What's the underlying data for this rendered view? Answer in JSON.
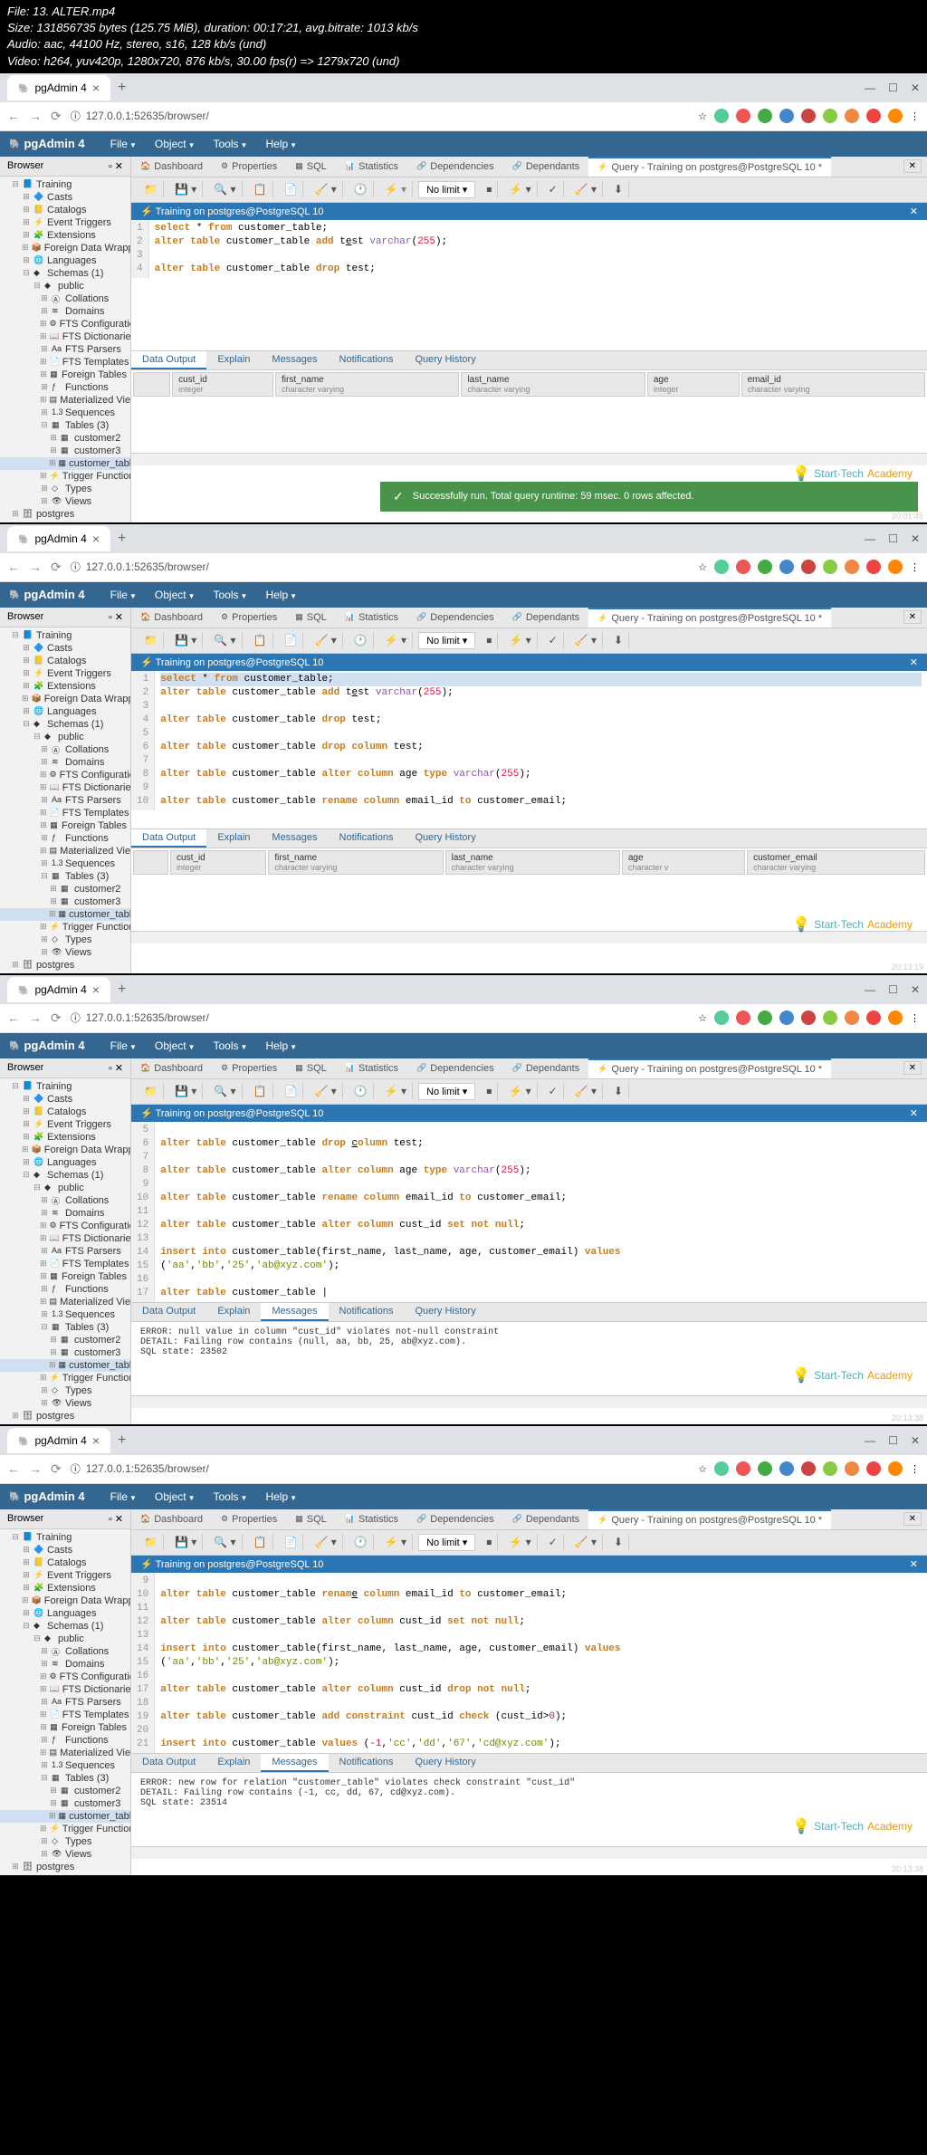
{
  "video_info": {
    "file": "File: 13. ALTER.mp4",
    "size": "Size: 131856735 bytes (125.75 MiB), duration: 00:17:21, avg.bitrate: 1013 kb/s",
    "audio": "Audio: aac, 44100 Hz, stereo, s16, 128 kb/s (und)",
    "video": "Video: h264, yuv420p, 1280x720, 876 kb/s, 30.00 fps(r) => 1279x720 (und)"
  },
  "chrome": {
    "tab_title": "pgAdmin 4",
    "url": "127.0.0.1:52635/browser/",
    "info_icon": "ⓘ"
  },
  "pgadmin": {
    "logo_text": "pgAdmin 4",
    "menu": [
      "File",
      "Object",
      "Tools",
      "Help"
    ]
  },
  "browser": {
    "title": "Browser",
    "tree": [
      {
        "ind": 1,
        "toggle": "⊟",
        "icon": "📘",
        "label": "Training"
      },
      {
        "ind": 2,
        "toggle": "⊞",
        "icon": "🔷",
        "label": "Casts"
      },
      {
        "ind": 2,
        "toggle": "⊞",
        "icon": "📒",
        "label": "Catalogs"
      },
      {
        "ind": 2,
        "toggle": "⊞",
        "icon": "⚡",
        "label": "Event Triggers"
      },
      {
        "ind": 2,
        "toggle": "⊞",
        "icon": "🧩",
        "label": "Extensions"
      },
      {
        "ind": 2,
        "toggle": "⊞",
        "icon": "📦",
        "label": "Foreign Data Wrappers"
      },
      {
        "ind": 2,
        "toggle": "⊞",
        "icon": "🌐",
        "label": "Languages"
      },
      {
        "ind": 2,
        "toggle": "⊟",
        "icon": "◆",
        "label": "Schemas (1)"
      },
      {
        "ind": 3,
        "toggle": "⊟",
        "icon": "◆",
        "label": "public"
      },
      {
        "ind": 4,
        "toggle": "⊞",
        "icon": "Ⓐ",
        "label": "Collations"
      },
      {
        "ind": 4,
        "toggle": "⊞",
        "icon": "≋",
        "label": "Domains"
      },
      {
        "ind": 4,
        "toggle": "⊞",
        "icon": "⚙",
        "label": "FTS Configurations"
      },
      {
        "ind": 4,
        "toggle": "⊞",
        "icon": "📖",
        "label": "FTS Dictionaries"
      },
      {
        "ind": 4,
        "toggle": "⊞",
        "icon": "Aa",
        "label": "FTS Parsers"
      },
      {
        "ind": 4,
        "toggle": "⊞",
        "icon": "📄",
        "label": "FTS Templates"
      },
      {
        "ind": 4,
        "toggle": "⊞",
        "icon": "▦",
        "label": "Foreign Tables"
      },
      {
        "ind": 4,
        "toggle": "⊞",
        "icon": "ƒ",
        "label": "Functions"
      },
      {
        "ind": 4,
        "toggle": "⊞",
        "icon": "▤",
        "label": "Materialized Views"
      },
      {
        "ind": 4,
        "toggle": "⊞",
        "icon": "1.3",
        "label": "Sequences"
      },
      {
        "ind": 4,
        "toggle": "⊟",
        "icon": "▦",
        "label": "Tables (3)"
      },
      {
        "ind": 5,
        "toggle": "⊞",
        "icon": "▦",
        "label": "customer2"
      },
      {
        "ind": 5,
        "toggle": "⊞",
        "icon": "▦",
        "label": "customer3"
      },
      {
        "ind": 5,
        "toggle": "⊞",
        "icon": "▦",
        "label": "customer_table",
        "selected": true
      },
      {
        "ind": 4,
        "toggle": "⊞",
        "icon": "⚡",
        "label": "Trigger Functions"
      },
      {
        "ind": 4,
        "toggle": "⊞",
        "icon": "◇",
        "label": "Types"
      },
      {
        "ind": 4,
        "toggle": "⊞",
        "icon": "👁",
        "label": "Views"
      },
      {
        "ind": 1,
        "toggle": "⊞",
        "icon": "🗄",
        "label": "postgres"
      }
    ]
  },
  "tabs": {
    "items": [
      {
        "icon": "🏠",
        "label": "Dashboard"
      },
      {
        "icon": "⚙",
        "label": "Properties"
      },
      {
        "icon": "▦",
        "label": "SQL"
      },
      {
        "icon": "📊",
        "label": "Statistics"
      },
      {
        "icon": "🔗",
        "label": "Dependencies"
      },
      {
        "icon": "🔗",
        "label": "Dependants"
      },
      {
        "icon": "⚡",
        "label": "Query - Training on postgres@PostgreSQL 10 *",
        "active": true
      }
    ]
  },
  "toolbar": {
    "no_limit": "No limit"
  },
  "query_header": "Training on postgres@PostgreSQL 10",
  "results_tabs": [
    "Data Output",
    "Explain",
    "Messages",
    "Notifications",
    "Query History"
  ],
  "watermark": {
    "brand": "Start-Tech",
    "suffix": "Academy"
  },
  "frame1": {
    "timestamp": "20:01:45",
    "code_lines": [
      "1",
      "2",
      "3",
      "4"
    ],
    "toast": "Successfully run. Total query runtime: 59 msec. 0 rows affected.",
    "columns": [
      {
        "name": "cust_id",
        "type": "integer"
      },
      {
        "name": "first_name",
        "type": "character varying"
      },
      {
        "name": "last_name",
        "type": "character varying"
      },
      {
        "name": "age",
        "type": "integer"
      },
      {
        "name": "email_id",
        "type": "character varying"
      }
    ]
  },
  "frame2": {
    "timestamp": "20:13:19",
    "code_lines": [
      "1",
      "2",
      "3",
      "4",
      "5",
      "6",
      "7",
      "8",
      "9",
      "10"
    ],
    "columns": [
      {
        "name": "cust_id",
        "type": "integer"
      },
      {
        "name": "first_name",
        "type": "character varying"
      },
      {
        "name": "last_name",
        "type": "character varying"
      },
      {
        "name": "age",
        "type": "character v"
      },
      {
        "name": "customer_email",
        "type": "character varying"
      }
    ]
  },
  "frame3": {
    "timestamp": "20:13:38",
    "code_lines": [
      "5",
      "6",
      "7",
      "8",
      "9",
      "10",
      "11",
      "12",
      "13",
      "14",
      "15",
      "16",
      "17"
    ],
    "msg": {
      "l1": "ERROR:  null value in column \"cust_id\" violates not-null constraint",
      "l2": "DETAIL:  Failing row contains (null, aa, bb, 25, ab@xyz.com).",
      "l3": "SQL state: 23502"
    }
  },
  "frame4": {
    "timestamp": "20:13:38",
    "code_lines": [
      "9",
      "10",
      "11",
      "12",
      "13",
      "14",
      "15",
      "16",
      "17",
      "18",
      "19",
      "20",
      "21"
    ],
    "msg": {
      "l1": "ERROR:  new row for relation \"customer_table\" violates check constraint \"cust_id\"",
      "l2": "DETAIL:  Failing row contains (-1, cc, dd, 67, cd@xyz.com).",
      "l3": "SQL state: 23514"
    }
  }
}
